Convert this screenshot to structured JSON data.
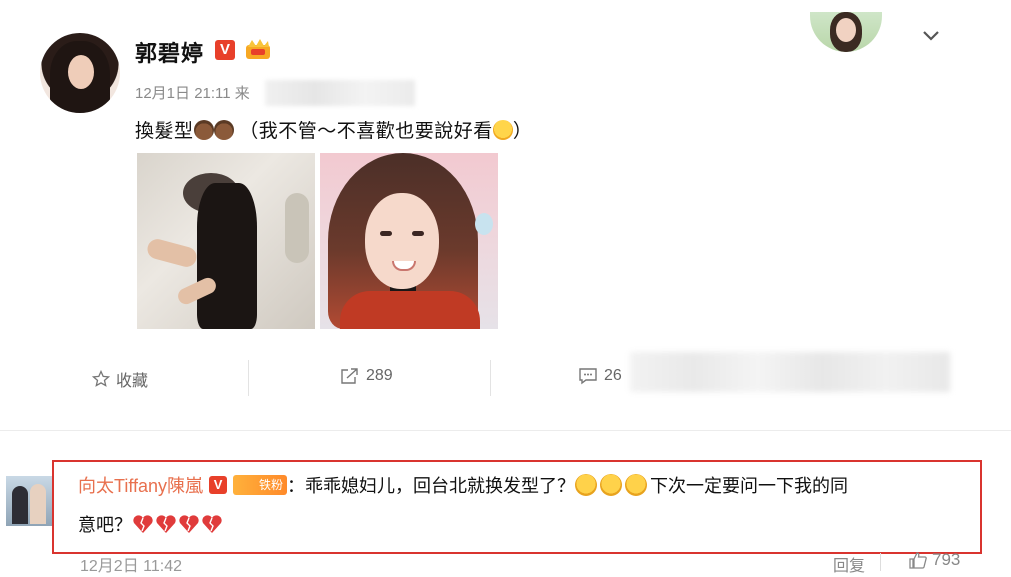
{
  "post": {
    "author": "郭碧婷",
    "verified_badge": "V",
    "meta": "12月1日 21:11 来",
    "text_main": "換髮型",
    "text_aside": "（我不管～不喜歡也要說好看",
    "text_close": "）"
  },
  "actions": {
    "favorite": "收藏",
    "share_count": "289",
    "comment_count": "26"
  },
  "comment": {
    "user": "向太Tiffany陳嵐",
    "verified_badge": "V",
    "fan_badge": "铁粉",
    "line1": "：乖乖媳妇儿，回台北就换发型了？",
    "line1_end": "下次一定要问一下我的同",
    "line2": "意吧？",
    "time": "12月2日 11:42",
    "reply_label": "回复",
    "like_count": "793"
  },
  "colors": {
    "accent_orange": "#e8704e",
    "highlight_red": "#d9342f",
    "badge_red": "#e8402a"
  }
}
